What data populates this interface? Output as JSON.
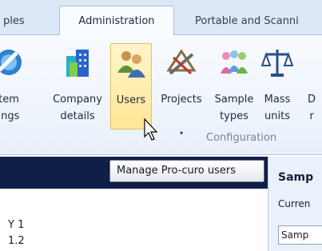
{
  "tabs": {
    "samples_partial": "ples",
    "administration": "Administration",
    "portable_partial": "Portable and Scanni"
  },
  "ribbon": {
    "buttons": [
      {
        "line1": "tem",
        "line2": "ings",
        "icon": "system-settings-icon"
      },
      {
        "line1": "Company",
        "line2": "details",
        "icon": "company-building-icon"
      },
      {
        "line1": "Users",
        "line2": "",
        "icon": "users-icon"
      },
      {
        "line1": "Projects",
        "line2": "",
        "icon": "projects-tools-icon",
        "dropdown": "▾"
      },
      {
        "line1": "Sample",
        "line2": "types",
        "icon": "sample-types-icon"
      },
      {
        "line1": "Mass",
        "line2": "units",
        "icon": "scales-icon"
      },
      {
        "line1": "D",
        "line2": "r",
        "icon": "partial-icon"
      }
    ],
    "group_label": "Configuration"
  },
  "tooltip": "Manage Pro-curo users",
  "content": {
    "left_lines": [
      "Y 1",
      "1.2"
    ]
  },
  "right_panel": {
    "title": "Samp",
    "current_label": "Curren",
    "input_value": "Samp"
  }
}
